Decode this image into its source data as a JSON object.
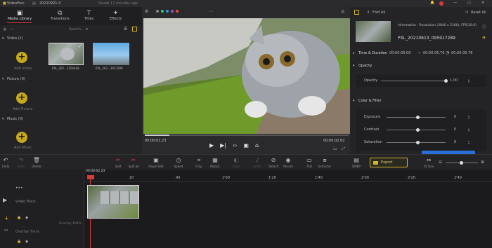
{
  "titlebar": {
    "app_name": "VideoProc",
    "project_name": "20210921-0",
    "save_status": "Saved 17 minutes ago"
  },
  "media_tabs": [
    {
      "label": "Media Library"
    },
    {
      "label": "Transitions"
    },
    {
      "label": "Titles"
    },
    {
      "label": "Effects"
    }
  ],
  "library": {
    "search_label": "Search...",
    "video_section": "Video (2)",
    "picture_section": "Picture (0)",
    "music_section": "Music (0)",
    "add_video": "Add Video",
    "add_picture": "Add Picture",
    "add_music": "Add Music",
    "clips": [
      {
        "name": "PXL_202...1256448"
      },
      {
        "name": "PXL_202...3917289"
      }
    ]
  },
  "preview": {
    "current_time": "00:00:02.23",
    "total_time": "00:00:02.62"
  },
  "inspector": {
    "fold_all": "Fold All",
    "reset_all": "Reset All",
    "info": "Information : Resolution (3840 x 2160), FPS(30.0)",
    "filename": "PXL_20210613_095917289",
    "time_duration": "Time & Duration",
    "start_time": "00:00:00.00",
    "end_time": "00:00:05.76",
    "duration": "00:00:05.76",
    "opacity_section": "Opacity",
    "opacity_label": "Opacity",
    "opacity_value": "1.00",
    "opacity_level": 1.0,
    "color_section": "Color & Filter",
    "exposure_label": "Exposure",
    "exposure_value": "0",
    "contrast_label": "Contrast",
    "contrast_value": "0",
    "saturation_label": "Saturation",
    "saturation_value": "0"
  },
  "toolbar": {
    "undo": "Undo",
    "redo": "Redo",
    "delete": "Delete",
    "split": "Split",
    "split_all": "Split all",
    "player_edit": "Player Edit",
    "speed": "Speed",
    "crop": "Crop",
    "mosaic": "Mosaic",
    "color": "Color",
    "audio": "Audio",
    "detach": "Detach",
    "record": "Record",
    "trial": "Trial",
    "extractor": "Extractor",
    "dmbp": "DMBP",
    "export": "Export",
    "fit_size": "Fit Size"
  },
  "timeline": {
    "playhead_time": "00:00:02.23",
    "ruler": [
      "20",
      "40",
      "1'00",
      "1'20",
      "1'40",
      "2'00",
      "2'20",
      "2'40"
    ],
    "video_track": "Video Track",
    "overlay_track": "Overlay Track",
    "track_label_2": "Overlay 100%"
  },
  "colors": {
    "accent": "#d4b429",
    "playhead": "#d63b3b",
    "export_border": "#d4b429"
  }
}
